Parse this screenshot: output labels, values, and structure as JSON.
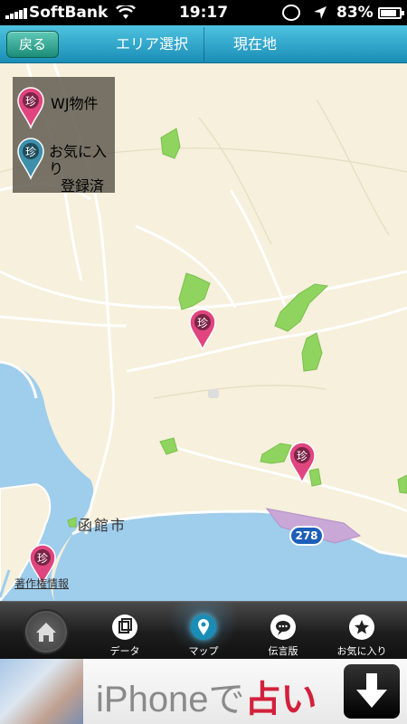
{
  "status_bar": {
    "carrier": "SoftBank",
    "time": "19:17",
    "battery": "83%",
    "battery_level": 0.83
  },
  "nav": {
    "back": "戻る",
    "area_select": "エリア選択",
    "current_location": "現在地"
  },
  "map": {
    "legend": {
      "wj": "WJ物件",
      "favorite_line1": "お気に入り",
      "favorite_line2": "登録済"
    },
    "pin_glyph": "珍",
    "city_label": "函館市",
    "route_number": "278",
    "copyright": "著作権情報",
    "colors": {
      "land": "#f6f0dc",
      "water": "#9fcdec",
      "park": "#8fd45f",
      "pin_pink": "#e0457f",
      "pin_blue": "#3e8faa"
    }
  },
  "tabbar": {
    "tabs": [
      {
        "label": "データ",
        "icon": "data-icon"
      },
      {
        "label": "マップ",
        "icon": "map-pin-icon"
      },
      {
        "label": "伝言版",
        "icon": "chat-icon"
      },
      {
        "label": "お気に入り",
        "icon": "star-icon"
      }
    ],
    "active_tab": "マップ",
    "home_icon": "home-icon"
  },
  "ad": {
    "text_pre": "iPhoneで",
    "text_red": "占い",
    "download_icon": "download-arrow-icon"
  }
}
